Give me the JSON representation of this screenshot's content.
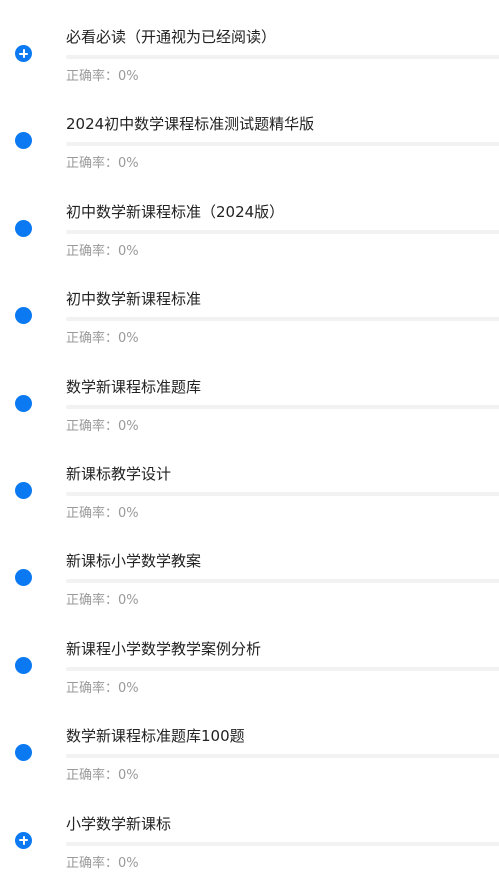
{
  "rate_label": "正确率：",
  "accent_color": "#0b7af2",
  "items": [
    {
      "title": "必看必读（开通视为已经阅读）",
      "rate": "0%",
      "progress": 0,
      "icon": "plus-circle-icon"
    },
    {
      "title": "2024初中数学课程标准测试题精华版",
      "rate": "0%",
      "progress": 0,
      "icon": "dot-icon"
    },
    {
      "title": "初中数学新课程标准（2024版）",
      "rate": "0%",
      "progress": 0,
      "icon": "dot-icon"
    },
    {
      "title": "初中数学新课程标准",
      "rate": "0%",
      "progress": 0,
      "icon": "dot-icon"
    },
    {
      "title": "数学新课程标准题库",
      "rate": "0%",
      "progress": 0,
      "icon": "dot-icon"
    },
    {
      "title": "新课标教学设计",
      "rate": "0%",
      "progress": 0,
      "icon": "dot-icon"
    },
    {
      "title": "新课标小学数学教案",
      "rate": "0%",
      "progress": 0,
      "icon": "dot-icon"
    },
    {
      "title": "新课程小学数学教学案例分析",
      "rate": "0%",
      "progress": 0,
      "icon": "dot-icon"
    },
    {
      "title": "数学新课程标准题库100题",
      "rate": "0%",
      "progress": 0,
      "icon": "dot-icon"
    },
    {
      "title": "小学数学新课标",
      "rate": "0%",
      "progress": 0,
      "icon": "plus-circle-icon"
    }
  ]
}
